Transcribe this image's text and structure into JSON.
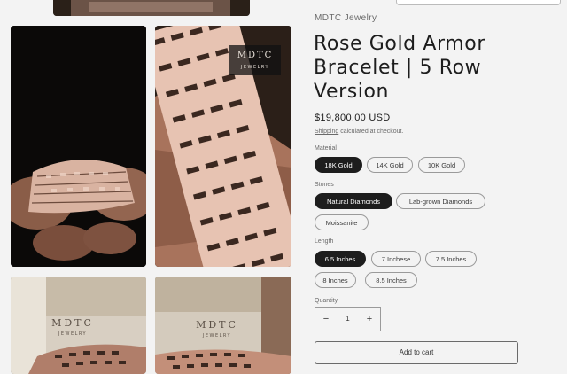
{
  "product": {
    "vendor": "MDTC Jewelry",
    "title": "Rose Gold Armor Bracelet | 5 Row Version",
    "price": "$19,800.00 USD",
    "shipping_link": "Shipping",
    "shipping_text": " calculated at checkout."
  },
  "gallery": {
    "brand_mark_line1": "MDTC",
    "brand_mark_line2": "JEWELRY"
  },
  "options": {
    "material": {
      "label": "Material",
      "values": [
        "18K Gold",
        "14K Gold",
        "10K Gold"
      ],
      "selected": "18K Gold"
    },
    "stones": {
      "label": "Stones",
      "values": [
        "Natural Diamonds",
        "Lab-grown Diamonds",
        "Moissanite"
      ],
      "selected": "Natural Diamonds"
    },
    "length": {
      "label": "Length",
      "values": [
        "6.5 Inches",
        "7 Inchese",
        "7.5 Inches",
        "8 Inches",
        "8.5 Inches"
      ],
      "selected": "6.5 Inches"
    }
  },
  "quantity": {
    "label": "Quantity",
    "value": "1",
    "minus": "−",
    "plus": "+"
  },
  "cart": {
    "add_label": "Add to cart"
  },
  "colors": {
    "accent": "#1d1d1d",
    "background": "#f3f3f3",
    "rose_gold": "#c89a86"
  },
  "icons": {
    "minus": "minus-icon",
    "plus": "plus-icon"
  }
}
